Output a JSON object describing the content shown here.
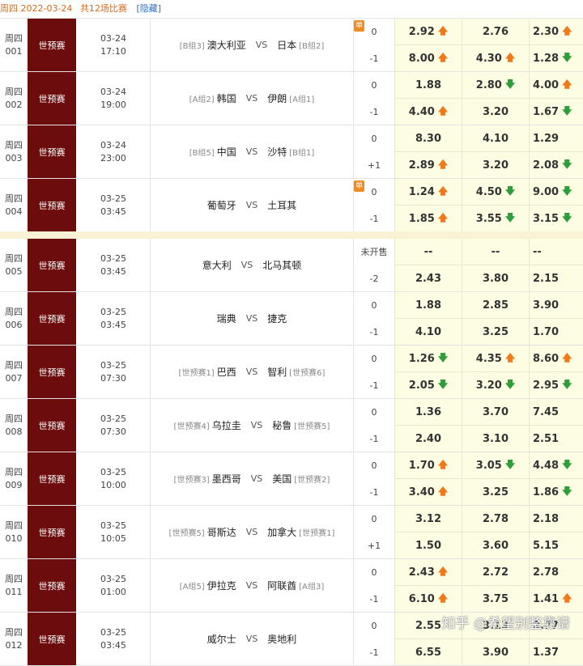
{
  "header": {
    "date_text": "周四 2022-03-24",
    "count_text": "共12场比赛",
    "hide_link": "[隐藏]"
  },
  "separator_after_row": 3,
  "matches": [
    {
      "day": "周四",
      "num": "001",
      "league": "世预赛",
      "date": "03-24",
      "time": "17:10",
      "home_group": "[B组3]",
      "home": "澳大利亚",
      "vs": "VS",
      "away": "日本",
      "away_group": "[B组2]",
      "single": "单",
      "hcp1": "0",
      "hcp2": "-1",
      "odds1": [
        {
          "v": "2.92",
          "a": "up"
        },
        {
          "v": "2.76",
          "a": ""
        },
        {
          "v": "2.30",
          "a": "up"
        }
      ],
      "odds2": [
        {
          "v": "8.00",
          "a": "up"
        },
        {
          "v": "4.30",
          "a": "up"
        },
        {
          "v": "1.28",
          "a": "down"
        }
      ]
    },
    {
      "day": "周四",
      "num": "002",
      "league": "世预赛",
      "date": "03-24",
      "time": "19:00",
      "home_group": "[A组2]",
      "home": "韩国",
      "vs": "VS",
      "away": "伊朗",
      "away_group": "[A组1]",
      "single": "",
      "hcp1": "0",
      "hcp2": "-1",
      "odds1": [
        {
          "v": "1.88",
          "a": ""
        },
        {
          "v": "2.80",
          "a": "down"
        },
        {
          "v": "4.00",
          "a": "up"
        }
      ],
      "odds2": [
        {
          "v": "4.40",
          "a": "up"
        },
        {
          "v": "3.20",
          "a": ""
        },
        {
          "v": "1.67",
          "a": "down"
        }
      ]
    },
    {
      "day": "周四",
      "num": "003",
      "league": "世预赛",
      "date": "03-24",
      "time": "23:00",
      "home_group": "[B组5]",
      "home": "中国",
      "vs": "VS",
      "away": "沙特",
      "away_group": "[B组1]",
      "single": "",
      "hcp1": "0",
      "hcp2": "+1",
      "odds1": [
        {
          "v": "8.30",
          "a": ""
        },
        {
          "v": "4.10",
          "a": ""
        },
        {
          "v": "1.29",
          "a": ""
        }
      ],
      "odds2": [
        {
          "v": "2.89",
          "a": "up"
        },
        {
          "v": "3.20",
          "a": ""
        },
        {
          "v": "2.08",
          "a": "down"
        }
      ]
    },
    {
      "day": "周四",
      "num": "004",
      "league": "世预赛",
      "date": "03-25",
      "time": "03:45",
      "home_group": "",
      "home": "葡萄牙",
      "vs": "VS",
      "away": "土耳其",
      "away_group": "",
      "single": "单",
      "hcp1": "0",
      "hcp2": "-1",
      "odds1": [
        {
          "v": "1.24",
          "a": "up"
        },
        {
          "v": "4.50",
          "a": "down"
        },
        {
          "v": "9.00",
          "a": "down"
        }
      ],
      "odds2": [
        {
          "v": "1.85",
          "a": "up"
        },
        {
          "v": "3.55",
          "a": "down"
        },
        {
          "v": "3.15",
          "a": "down"
        }
      ]
    },
    {
      "day": "周四",
      "num": "005",
      "league": "世预赛",
      "date": "03-25",
      "time": "03:45",
      "home_group": "",
      "home": "意大利",
      "vs": "VS",
      "away": "北马其顿",
      "away_group": "",
      "single": "",
      "hcp1": "未开售",
      "hcp2": "-2",
      "odds1": [
        {
          "v": "--",
          "a": ""
        },
        {
          "v": "--",
          "a": ""
        },
        {
          "v": "--",
          "a": ""
        }
      ],
      "odds2": [
        {
          "v": "2.43",
          "a": ""
        },
        {
          "v": "3.80",
          "a": ""
        },
        {
          "v": "2.15",
          "a": ""
        }
      ]
    },
    {
      "day": "周四",
      "num": "006",
      "league": "世预赛",
      "date": "03-25",
      "time": "03:45",
      "home_group": "",
      "home": "瑞典",
      "vs": "VS",
      "away": "捷克",
      "away_group": "",
      "single": "",
      "hcp1": "0",
      "hcp2": "-1",
      "odds1": [
        {
          "v": "1.88",
          "a": ""
        },
        {
          "v": "2.85",
          "a": ""
        },
        {
          "v": "3.90",
          "a": ""
        }
      ],
      "odds2": [
        {
          "v": "4.10",
          "a": ""
        },
        {
          "v": "3.25",
          "a": ""
        },
        {
          "v": "1.70",
          "a": ""
        }
      ]
    },
    {
      "day": "周四",
      "num": "007",
      "league": "世预赛",
      "date": "03-25",
      "time": "07:30",
      "home_group": "[世预赛1]",
      "home": "巴西",
      "vs": "VS",
      "away": "智利",
      "away_group": "[世预赛6]",
      "single": "",
      "hcp1": "0",
      "hcp2": "-1",
      "odds1": [
        {
          "v": "1.26",
          "a": "down"
        },
        {
          "v": "4.35",
          "a": "up"
        },
        {
          "v": "8.60",
          "a": "up"
        }
      ],
      "odds2": [
        {
          "v": "2.05",
          "a": "down"
        },
        {
          "v": "3.20",
          "a": "down"
        },
        {
          "v": "2.95",
          "a": "down"
        }
      ]
    },
    {
      "day": "周四",
      "num": "008",
      "league": "世预赛",
      "date": "03-25",
      "time": "07:30",
      "home_group": "[世预赛4]",
      "home": "乌拉圭",
      "vs": "VS",
      "away": "秘鲁",
      "away_group": "[世预赛5]",
      "single": "",
      "hcp1": "0",
      "hcp2": "-1",
      "odds1": [
        {
          "v": "1.36",
          "a": ""
        },
        {
          "v": "3.70",
          "a": ""
        },
        {
          "v": "7.45",
          "a": ""
        }
      ],
      "odds2": [
        {
          "v": "2.40",
          "a": ""
        },
        {
          "v": "3.10",
          "a": ""
        },
        {
          "v": "2.51",
          "a": ""
        }
      ]
    },
    {
      "day": "周四",
      "num": "009",
      "league": "世预赛",
      "date": "03-25",
      "time": "10:00",
      "home_group": "[世预赛3]",
      "home": "墨西哥",
      "vs": "VS",
      "away": "美国",
      "away_group": "[世预赛2]",
      "single": "",
      "hcp1": "0",
      "hcp2": "-1",
      "odds1": [
        {
          "v": "1.70",
          "a": "up"
        },
        {
          "v": "3.05",
          "a": "down"
        },
        {
          "v": "4.48",
          "a": "down"
        }
      ],
      "odds2": [
        {
          "v": "3.40",
          "a": "up"
        },
        {
          "v": "3.25",
          "a": ""
        },
        {
          "v": "1.86",
          "a": "down"
        }
      ]
    },
    {
      "day": "周四",
      "num": "010",
      "league": "世预赛",
      "date": "03-25",
      "time": "10:05",
      "home_group": "[世预赛5]",
      "home": "哥斯达",
      "vs": "VS",
      "away": "加拿大",
      "away_group": "[世预赛1]",
      "single": "",
      "hcp1": "0",
      "hcp2": "+1",
      "odds1": [
        {
          "v": "3.12",
          "a": ""
        },
        {
          "v": "2.78",
          "a": ""
        },
        {
          "v": "2.18",
          "a": ""
        }
      ],
      "odds2": [
        {
          "v": "1.50",
          "a": ""
        },
        {
          "v": "3.60",
          "a": ""
        },
        {
          "v": "5.15",
          "a": ""
        }
      ]
    },
    {
      "day": "周四",
      "num": "011",
      "league": "世预赛",
      "date": "03-25",
      "time": "01:00",
      "home_group": "[A组5]",
      "home": "伊拉克",
      "vs": "VS",
      "away": "阿联酋",
      "away_group": "[A组3]",
      "single": "",
      "hcp1": "0",
      "hcp2": "-1",
      "odds1": [
        {
          "v": "2.43",
          "a": "up"
        },
        {
          "v": "2.72",
          "a": ""
        },
        {
          "v": "2.78",
          "a": ""
        }
      ],
      "odds2": [
        {
          "v": "6.10",
          "a": "up"
        },
        {
          "v": "3.75",
          "a": ""
        },
        {
          "v": "1.41",
          "a": "up"
        }
      ]
    },
    {
      "day": "周四",
      "num": "012",
      "league": "世预赛",
      "date": "03-25",
      "time": "03:45",
      "home_group": "",
      "home": "威尔士",
      "vs": "VS",
      "away": "奥地利",
      "away_group": "",
      "single": "",
      "hcp1": "0",
      "hcp2": "-1",
      "odds1": [
        {
          "v": "2.55",
          "a": ""
        },
        {
          "v": "3.13",
          "a": ""
        },
        {
          "v": "2.77",
          "a": ""
        }
      ],
      "odds2": [
        {
          "v": "6.55",
          "a": ""
        },
        {
          "v": "3.90",
          "a": ""
        },
        {
          "v": "1.37",
          "a": ""
        }
      ]
    }
  ],
  "arrows": {
    "up": "🡅",
    "down": "🡇"
  },
  "watermark": "知乎 @希望别整靠谱"
}
